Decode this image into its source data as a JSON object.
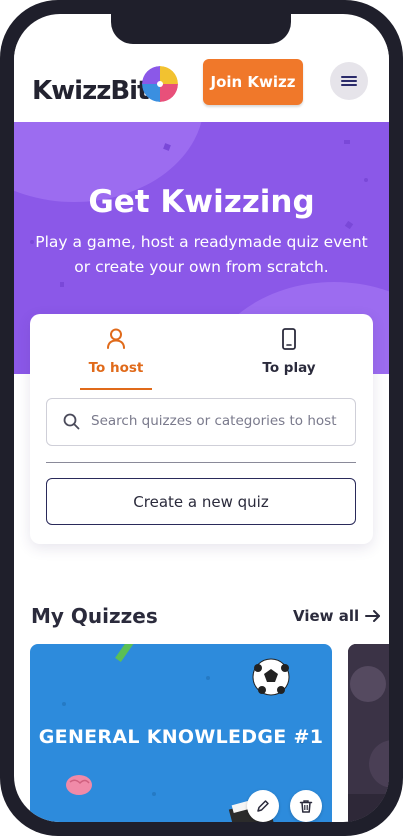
{
  "header": {
    "logo_text": "KwizzBit",
    "join_label": "Join Kwizz",
    "menu_icon": "hamburger-icon"
  },
  "hero": {
    "title": "Get Kwizzing",
    "subtitle": "Play a game, host a readymade quiz event or create your own from scratch."
  },
  "tabs": [
    {
      "label": "To host",
      "icon": "person-icon",
      "active": true
    },
    {
      "label": "To play",
      "icon": "phone-icon",
      "active": false
    }
  ],
  "search": {
    "placeholder": "Search quizzes or categories to host"
  },
  "create_label": "Create a new quiz",
  "my_quizzes": {
    "title": "My Quizzes",
    "view_all": "View all",
    "cards": [
      {
        "title": "GENERAL KNOWLEDGE #1"
      }
    ]
  },
  "colors": {
    "hero": "#8b58e8",
    "accent": "#f0782a",
    "card_blue": "#2d8bdc"
  }
}
